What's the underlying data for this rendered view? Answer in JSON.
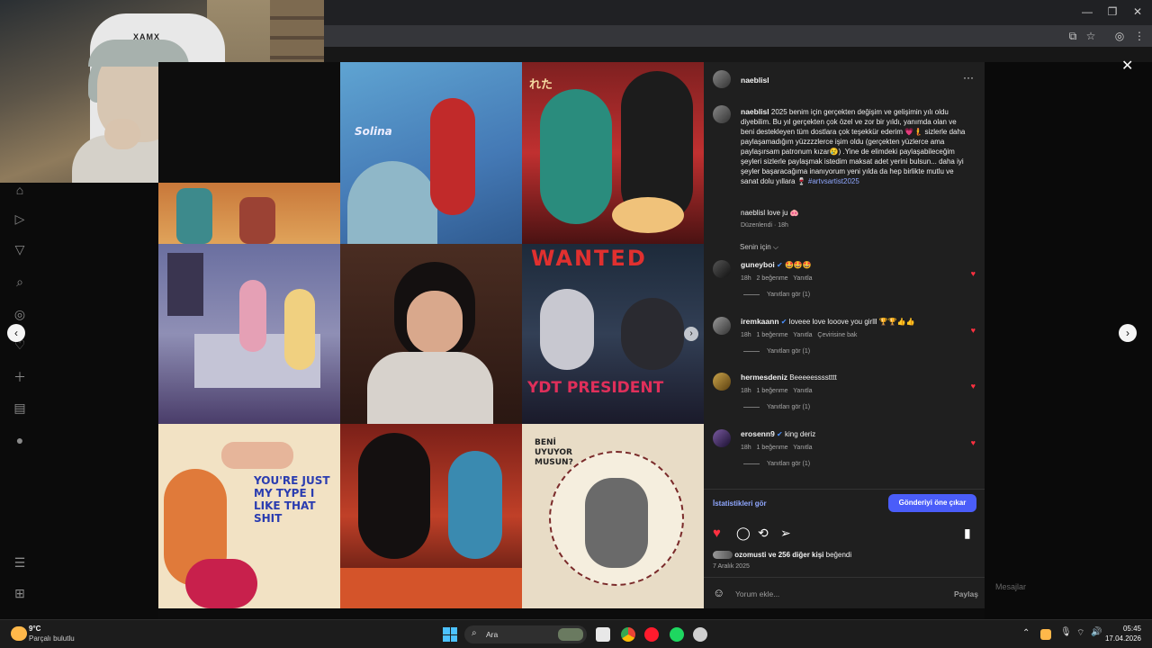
{
  "post": {
    "username": "naeblisl",
    "caption_user": "naeblisl",
    "caption_text": "2025 benim için gerçekten değişim ve gelişimin yılı oldu diyebilim. Bu yıl gerçekten çok özel ve zor bir yıldı, yanımda olan ve beni destekleyen tüm dostlara çok teşekkür ederim 💗🧜 sizlerle daha paylaşamadığım yüzzzzlerce işim oldu (gerçekten yüzlerce ama paylaşırsam patronum kızar😢) .Yine de elimdeki paylaşabileceğim şeyleri sizlerle paylaşmak istedim maksat adet yerini bulsun... daha iyi şeyler başaracağıma inanıyorum yeni yılda da hep birlikte mutlu ve sanat dolu yıllara 🍷",
    "hashtag": "#artvsartist2025",
    "self_comment_user": "naeblisl",
    "self_comment_text": "love ju 🐽",
    "edited": "Düzenlendi · 18h",
    "sort_label": "Senin için ⌵",
    "insights": "İstatistikleri gör",
    "promote": "Gönderiyi öne çıkar",
    "likes_user": "ozomusti",
    "likes_rest": "ve 256 diğer kişi",
    "likes_suffix": "beğendi",
    "date": "7 Aralık 2025",
    "comment_placeholder": "Yorum ekle...",
    "share_button": "Paylaş"
  },
  "comments": [
    {
      "user": "guneyboi",
      "text": "🤩🤩🤩",
      "time": "18h",
      "likes": "2 beğenme",
      "reply": "Yanıtla",
      "extra": "",
      "replies": "Yanıtları gör (1)"
    },
    {
      "user": "iremkaann",
      "text": "loveee love looove you girlll 🏆🏆👍👍",
      "time": "18h",
      "likes": "1 beğenme",
      "reply": "Yanıtla",
      "extra": "Çevirisine bak",
      "replies": "Yanıtları gör (1)"
    },
    {
      "user": "hermesdeniz",
      "text": "Beeeeesssstttt",
      "time": "18h",
      "likes": "1 beğenme",
      "reply": "Yanıtla",
      "extra": "",
      "replies": "Yanıtları gör (1)"
    },
    {
      "user": "erosenn9",
      "text": "king deriz",
      "time": "18h",
      "likes": "1 beğenme",
      "reply": "Yanıtla",
      "extra": "",
      "replies": "Yanıtları gör (1)"
    }
  ],
  "tiles": {
    "solina": "Solina",
    "wanted": "WANTED",
    "ydt": "YDT PRESIDENT",
    "shit": "YOU'RE JUST MY TYPE I LIKE THAT SHIT",
    "kim": "BENİ UYUYOR MUSUN?",
    "ramen": "れた"
  },
  "background": {
    "messages": "Mesajlar"
  },
  "taskbar": {
    "weather_temp": "9°C",
    "weather_desc": "Parçalı bulutlu",
    "search": "Ara",
    "time": "05:45",
    "date": "17.04.2026"
  },
  "icons": [
    "home-icon",
    "video-icon",
    "filter-icon",
    "search-icon",
    "compass-icon",
    "heart-icon",
    "plus-icon",
    "chart-icon",
    "globe-icon",
    "menu-icon",
    "apps-icon"
  ],
  "colors": {
    "accent": "#4a5df9",
    "like": "#ff3040",
    "panel": "#1f1f1f"
  }
}
